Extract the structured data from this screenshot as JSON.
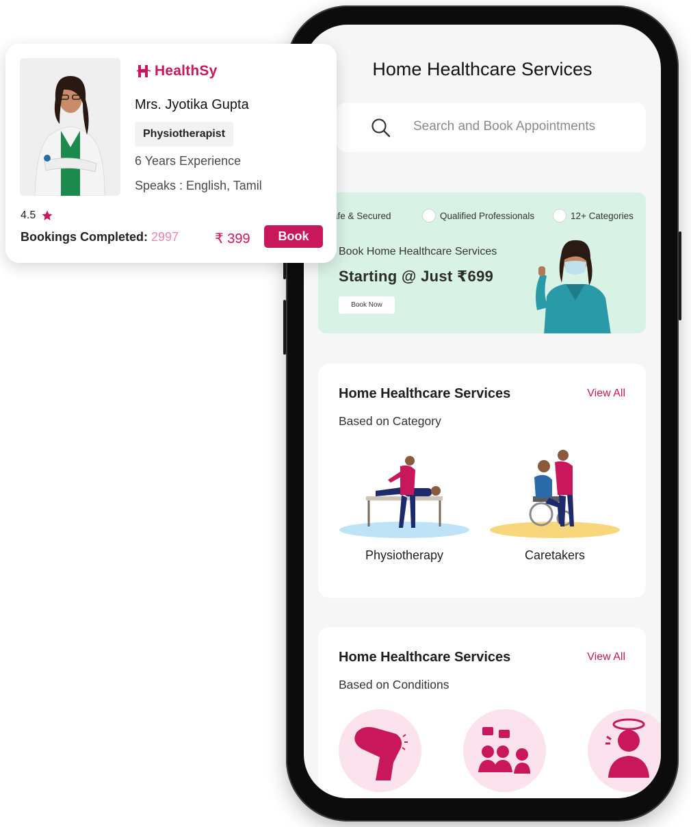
{
  "app": {
    "title": "Home Healthcare Services",
    "search_placeholder": "Search and Book Appointments"
  },
  "banner": {
    "features": [
      "Safe & Secured",
      "Qualified Professionals",
      "12+ Categories"
    ],
    "subtitle": "Book Home Healthcare Services",
    "headline": "Starting @ Just ₹699",
    "button_label": "Book Now",
    "bg_color": "#d9f2e6"
  },
  "category_section": {
    "title": "Home Healthcare Services",
    "view_all": "View All",
    "subtitle": "Based on Category",
    "items": [
      {
        "label": "Physiotherapy",
        "icon": "physiotherapy-illustration"
      },
      {
        "label": "Caretakers",
        "icon": "caretaker-illustration"
      }
    ]
  },
  "conditions_section": {
    "title": "Home Healthcare Services",
    "view_all": "View All",
    "subtitle": "Based on Conditions",
    "items": [
      {
        "icon": "knee-icon"
      },
      {
        "icon": "group-consult-icon"
      },
      {
        "icon": "dizziness-icon"
      }
    ]
  },
  "doctor_card": {
    "brand": "HealthSy",
    "name": "Mrs. Jyotika Gupta",
    "specialty": "Physiotherapist",
    "experience": "6 Years Experience",
    "languages": "Speaks : English, Tamil",
    "rating": "4.5",
    "bookings_label": "Bookings Completed:",
    "bookings_count": "2997",
    "price": "₹ 399",
    "book_label": "Book"
  },
  "colors": {
    "accent": "#c8175a",
    "accent_light": "#e889ae",
    "screen_bg": "#f6f6f7"
  }
}
